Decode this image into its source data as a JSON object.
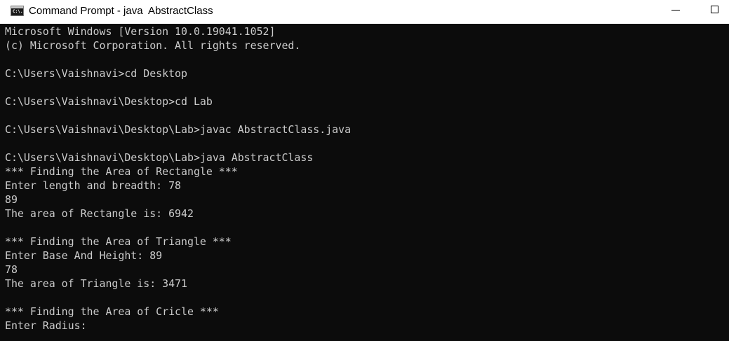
{
  "window": {
    "title": "Command Prompt - java  AbstractClass",
    "icon": "cmd-icon",
    "icon_glyph": "C:\\."
  },
  "console": {
    "lines": [
      "Microsoft Windows [Version 10.0.19041.1052]",
      "(c) Microsoft Corporation. All rights reserved.",
      "",
      "C:\\Users\\Vaishnavi>cd Desktop",
      "",
      "C:\\Users\\Vaishnavi\\Desktop>cd Lab",
      "",
      "C:\\Users\\Vaishnavi\\Desktop\\Lab>javac AbstractClass.java",
      "",
      "C:\\Users\\Vaishnavi\\Desktop\\Lab>java AbstractClass",
      "*** Finding the Area of Rectangle ***",
      "Enter length and breadth: 78",
      "89",
      "The area of Rectangle is: 6942",
      "",
      "*** Finding the Area of Triangle ***",
      "Enter Base And Height: 89",
      "78",
      "The area of Triangle is: 3471",
      "",
      "*** Finding the Area of Cricle ***",
      "Enter Radius:"
    ]
  },
  "colors": {
    "console_bg": "#0c0c0c",
    "console_fg": "#cccccc",
    "titlebar_bg": "#ffffff"
  }
}
